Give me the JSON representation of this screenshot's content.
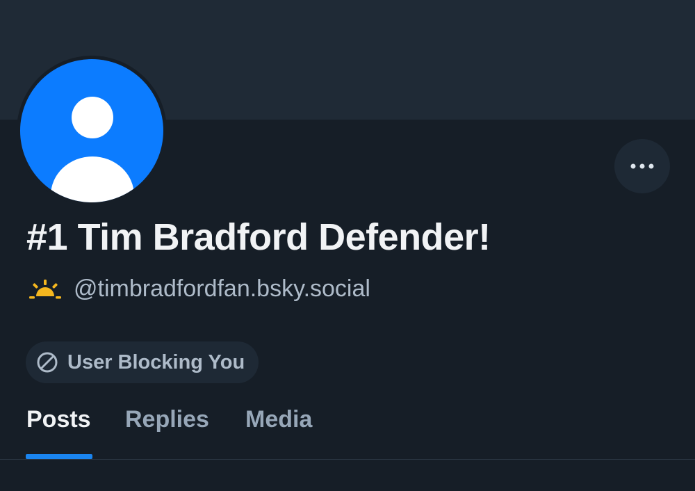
{
  "profile": {
    "display_name": "#1 Tim Bradford Defender!",
    "handle": "@timbradfordfan.bsky.social",
    "status_label": "User Blocking You",
    "avatar_icon": "default-user-avatar-icon",
    "handle_icon": "sunrise-icon",
    "more_icon": "ellipsis-icon"
  },
  "tabs": [
    {
      "label": "Posts",
      "active": true
    },
    {
      "label": "Replies",
      "active": false
    },
    {
      "label": "Media",
      "active": false
    }
  ],
  "colors": {
    "accent": "#1a85f0",
    "avatar": "#0c7cff",
    "background": "#161e27",
    "banner": "#1f2a36",
    "sun": "#f5b71f"
  }
}
